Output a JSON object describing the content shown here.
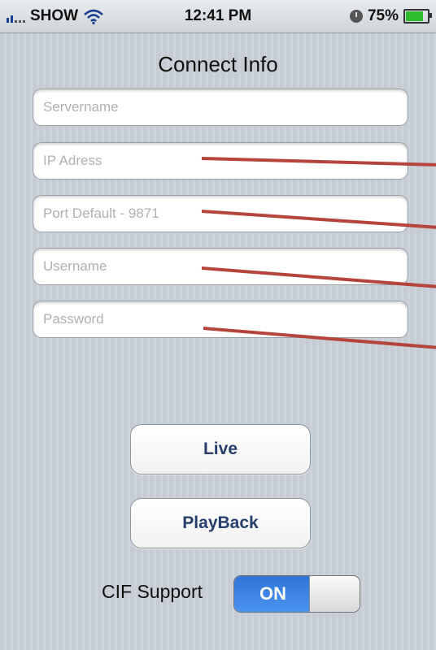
{
  "status_bar": {
    "carrier": "SHOW",
    "time": "12:41 PM",
    "battery_percent": "75%",
    "battery_level": 0.75,
    "icons": [
      "signal-icon",
      "wifi-icon",
      "clock-icon",
      "battery-icon"
    ]
  },
  "page": {
    "title": "Connect Info"
  },
  "form": {
    "servername_placeholder": "Servername",
    "ip_placeholder": "IP Adress",
    "port_placeholder": "Port Default - 9871",
    "username_placeholder": "Username",
    "password_placeholder": "Password"
  },
  "buttons": {
    "live_label": "Live",
    "playback_label": "PlayBack"
  },
  "cif": {
    "label": "CIF Support",
    "toggle_state": "ON"
  },
  "colors": {
    "toggle_on": "#3a80e0",
    "button_text": "#263e6b",
    "annotation_line": "#b5443c",
    "background": "#c5ccd4"
  }
}
